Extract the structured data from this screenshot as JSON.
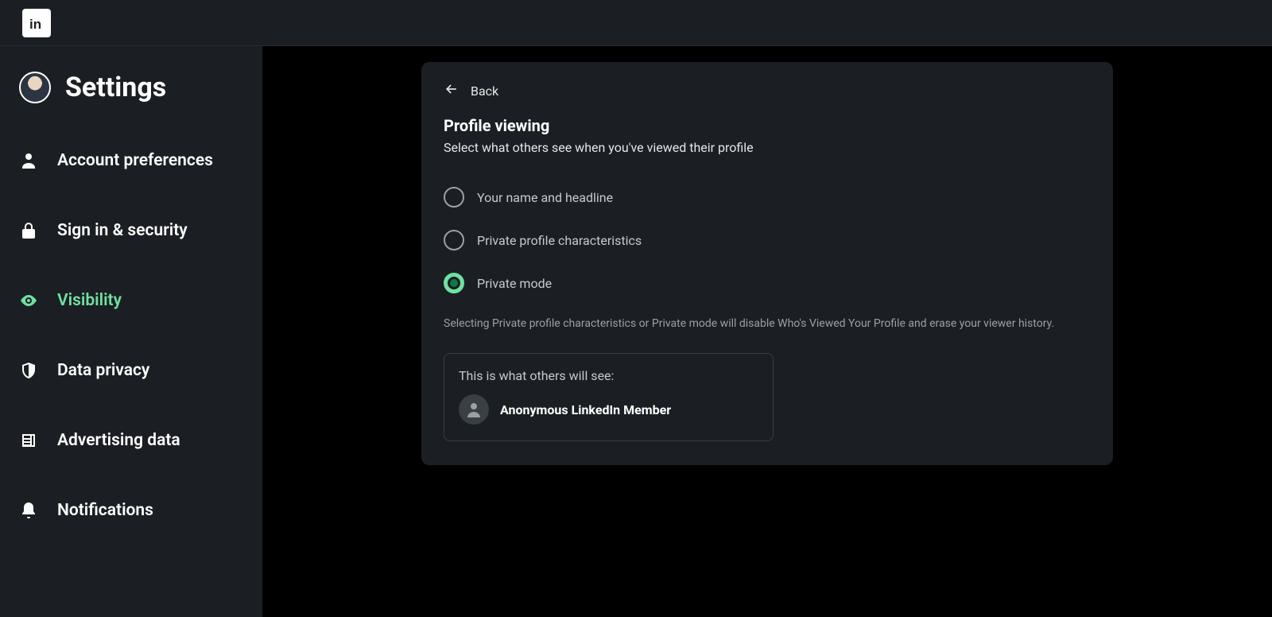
{
  "header": {
    "brand": "LinkedIn"
  },
  "sidebar": {
    "title": "Settings",
    "items": [
      {
        "label": "Account preferences",
        "icon": "person-icon",
        "active": false
      },
      {
        "label": "Sign in & security",
        "icon": "lock-icon",
        "active": false
      },
      {
        "label": "Visibility",
        "icon": "eye-icon",
        "active": true
      },
      {
        "label": "Data privacy",
        "icon": "shield-icon",
        "active": false
      },
      {
        "label": "Advertising data",
        "icon": "newspaper-icon",
        "active": false
      },
      {
        "label": "Notifications",
        "icon": "bell-icon",
        "active": false
      }
    ]
  },
  "panel": {
    "back_label": "Back",
    "title": "Profile viewing",
    "subtitle": "Select what others see when you've viewed their profile",
    "options": [
      {
        "label": "Your name and headline",
        "selected": false
      },
      {
        "label": "Private profile characteristics",
        "selected": false
      },
      {
        "label": "Private mode",
        "selected": true
      }
    ],
    "hint": "Selecting Private profile characteristics or Private mode will disable Who's Viewed Your Profile and erase your viewer history.",
    "preview": {
      "label": "This is what others will see:",
      "name": "Anonymous LinkedIn Member"
    }
  }
}
